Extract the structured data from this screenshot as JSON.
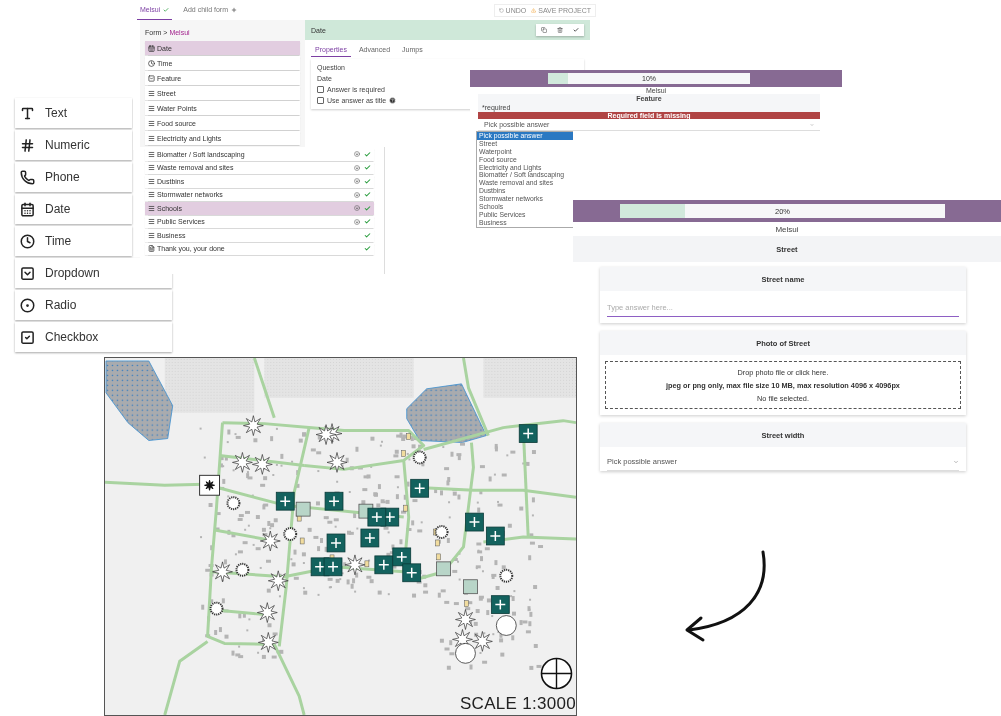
{
  "field_palette": {
    "items": [
      {
        "label": "Text"
      },
      {
        "label": "Numeric"
      },
      {
        "label": "Phone"
      },
      {
        "label": "Date"
      },
      {
        "label": "Time"
      },
      {
        "label": "Dropdown"
      },
      {
        "label": "Radio"
      },
      {
        "label": "Checkbox"
      }
    ]
  },
  "form_builder": {
    "tabs": [
      {
        "label": "Melsui",
        "selected": true,
        "done": true
      },
      {
        "label": "Add child form",
        "selected": false,
        "done": false
      }
    ],
    "actions": [
      "UNDO",
      "SAVE PROJECT"
    ],
    "breadcrumb": {
      "root": "Form >",
      "current": "Melsui"
    },
    "items": [
      {
        "label": "Date",
        "kind": "date",
        "selected": true
      },
      {
        "label": "Time",
        "kind": "time",
        "selected": false
      },
      {
        "label": "Feature",
        "kind": "dropdown",
        "selected": false
      },
      {
        "label": "Street",
        "kind": "form",
        "selected": false
      },
      {
        "label": "Water Points",
        "kind": "form",
        "selected": false
      },
      {
        "label": "Food source",
        "kind": "form",
        "selected": false
      },
      {
        "label": "Electricity and Lights",
        "kind": "form",
        "selected": false
      }
    ],
    "editor": {
      "title": "Date",
      "tabs": [
        {
          "label": "Properties",
          "selected": true
        },
        {
          "label": "Advanced",
          "selected": false
        },
        {
          "label": "Jumps",
          "selected": false
        }
      ],
      "question_label": "Question",
      "question_value": "Date",
      "options": [
        {
          "label": "Answer is required",
          "checked": false,
          "help": false
        },
        {
          "label": "Use answer as title",
          "checked": false,
          "help": true
        }
      ]
    }
  },
  "form_list": {
    "items": [
      {
        "label": "Biomatter / Soft landscaping",
        "kind": "form",
        "selected": false,
        "jump": true,
        "done": true
      },
      {
        "label": "Waste removal and sites",
        "kind": "form",
        "selected": false,
        "jump": true,
        "done": true
      },
      {
        "label": "Dustbins",
        "kind": "form",
        "selected": false,
        "jump": true,
        "done": true
      },
      {
        "label": "Stormwater networks",
        "kind": "form",
        "selected": false,
        "jump": true,
        "done": true
      },
      {
        "label": "Schools",
        "kind": "form",
        "selected": true,
        "jump": true,
        "done": true
      },
      {
        "label": "Public Services",
        "kind": "form",
        "selected": false,
        "jump": true,
        "done": true
      },
      {
        "label": "Business",
        "kind": "form",
        "selected": false,
        "jump": false,
        "done": true
      },
      {
        "label": "Thank you, your done",
        "kind": "end",
        "selected": false,
        "jump": false,
        "done": true
      }
    ]
  },
  "small_preview": {
    "progress": {
      "level": 0.1,
      "reading": "10%"
    },
    "form_title": "Melsui",
    "section": "Feature",
    "required_note": "*required",
    "error": "Required field is missing",
    "select_value": "Pick possible answer",
    "options": [
      {
        "label": "Pick possible answer",
        "selected": true
      },
      {
        "label": "Street",
        "selected": false
      },
      {
        "label": "Waterpoint",
        "selected": false
      },
      {
        "label": "Food source",
        "selected": false
      },
      {
        "label": "Electricity and Lights",
        "selected": false
      },
      {
        "label": "Biomatter / Soft landscaping",
        "selected": false
      },
      {
        "label": "Waste removal and sites",
        "selected": false
      },
      {
        "label": "Dustbins",
        "selected": false
      },
      {
        "label": "Stormwater networks",
        "selected": false
      },
      {
        "label": "Schools",
        "selected": false
      },
      {
        "label": "Public Services",
        "selected": false
      },
      {
        "label": "Business",
        "selected": false
      }
    ]
  },
  "large_preview": {
    "progress": {
      "level": 0.2,
      "reading": "20%"
    },
    "form_title": "Melsui",
    "section": "Street",
    "questions": [
      {
        "kind": "text",
        "title": "Street name",
        "placeholder": "Type answer here..."
      },
      {
        "kind": "photo",
        "title": "Photo of Street",
        "lines": [
          "Drop photo file or click here.",
          "jpeg or png only, max file size 10 MB, max resolution 4096 x 4096px",
          "No file selected."
        ]
      },
      {
        "kind": "select",
        "title": "Street width",
        "value": "Pick possible answer"
      }
    ]
  },
  "map": {
    "scale": "SCALE 1:3000"
  }
}
